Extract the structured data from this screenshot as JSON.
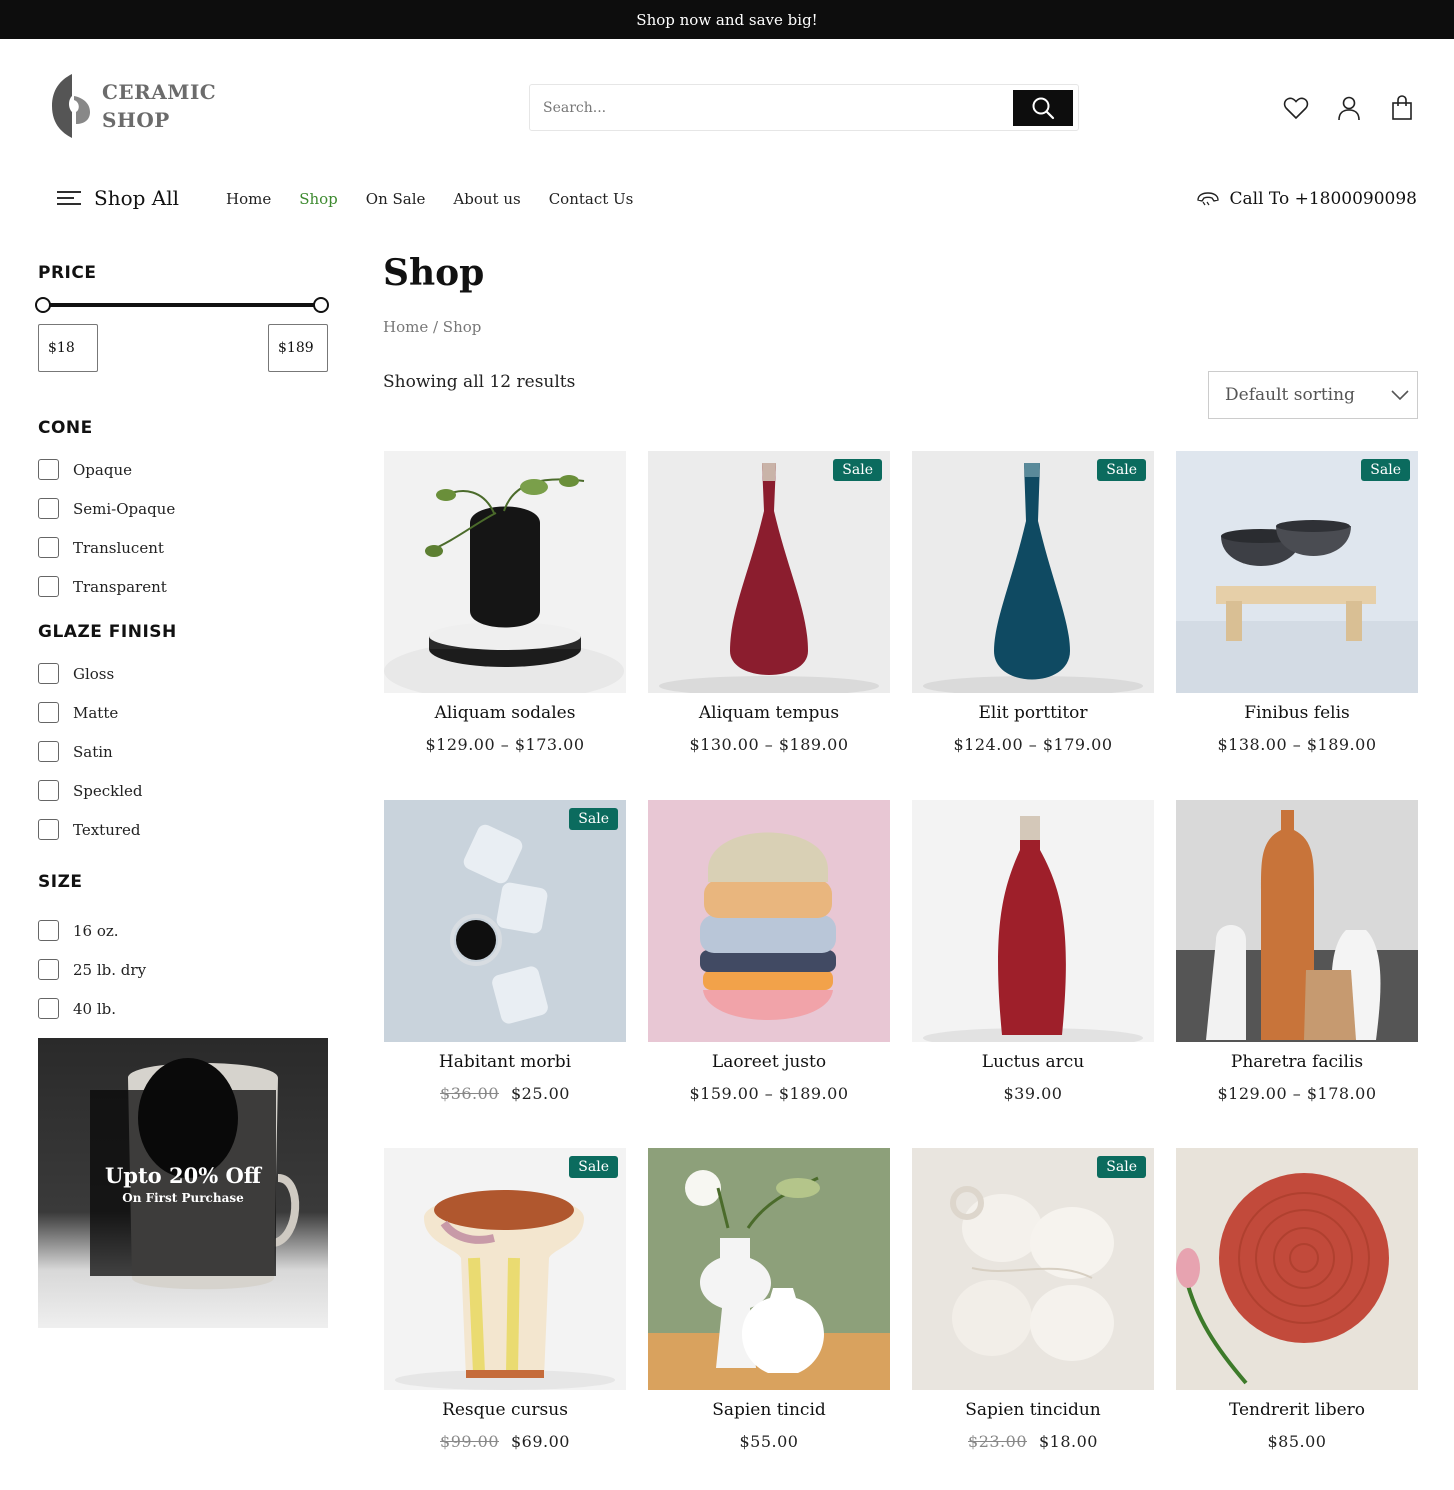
{
  "topbar": {
    "message": "Shop now and save big!"
  },
  "brand": {
    "line1": "CERAMIC",
    "line2": "SHOP"
  },
  "search": {
    "placeholder": "Search..."
  },
  "nav": {
    "shop_all": "Shop All",
    "items": [
      "Home",
      "Shop",
      "On Sale",
      "About us",
      "Contact Us"
    ],
    "active": "Shop",
    "call": "Call To +1800090098"
  },
  "sidebar": {
    "price": {
      "title": "PRICE",
      "min": "$18",
      "max": "$189"
    },
    "cone": {
      "title": "CONE",
      "options": [
        "Opaque",
        "Semi-Opaque",
        "Translucent",
        "Transparent"
      ]
    },
    "glaze": {
      "title": "GLAZE FINISH",
      "options": [
        "Gloss",
        "Matte",
        "Satin",
        "Speckled",
        "Textured"
      ]
    },
    "size": {
      "title": "SIZE",
      "options": [
        "16 oz.",
        "25 lb. dry",
        "40 lb."
      ]
    },
    "promo": {
      "title": "Upto 20% Off",
      "subtitle": "On First Purchase"
    }
  },
  "main": {
    "title": "Shop",
    "breadcrumb": "Home / Shop",
    "result_count": "Showing all 12 results",
    "sort": "Default sorting",
    "sale_label": "Sale"
  },
  "products": [
    {
      "name": "Aliquam sodales",
      "price": "$129.00 – $173.00",
      "old_price": "",
      "sale": false,
      "image": "black-vase-plant"
    },
    {
      "name": "Aliquam tempus",
      "price": "$130.00 – $189.00",
      "old_price": "",
      "sale": true,
      "image": "red-bud-vase"
    },
    {
      "name": "Elit porttitor",
      "price": "$124.00 – $179.00",
      "old_price": "",
      "sale": true,
      "image": "blue-bud-vase"
    },
    {
      "name": "Finibus felis",
      "price": "$138.00 – $189.00",
      "old_price": "",
      "sale": true,
      "image": "bowls-on-stand"
    },
    {
      "name": "Habitant morbi",
      "price": "$25.00",
      "old_price": "$36.00",
      "sale": true,
      "image": "textured-cups"
    },
    {
      "name": "Laoreet justo",
      "price": "$159.00 – $189.00",
      "old_price": "",
      "sale": false,
      "image": "stacked-bowls"
    },
    {
      "name": "Luctus arcu",
      "price": "$39.00",
      "old_price": "",
      "sale": false,
      "image": "red-tall-vase"
    },
    {
      "name": "Pharetra facilis",
      "price": "$129.00 – $178.00",
      "old_price": "",
      "sale": false,
      "image": "bottle-group"
    },
    {
      "name": "Resque cursus",
      "price": "$69.00",
      "old_price": "$99.00",
      "sale": true,
      "image": "painted-pot"
    },
    {
      "name": "Sapien tincid",
      "price": "$55.00",
      "old_price": "",
      "sale": false,
      "image": "white-vases"
    },
    {
      "name": "Sapien tincidun",
      "price": "$18.00",
      "old_price": "$23.00",
      "sale": true,
      "image": "white-cups-pile"
    },
    {
      "name": "Tendrerit libero",
      "price": "$85.00",
      "old_price": "",
      "sale": false,
      "image": "terracotta-plate"
    }
  ],
  "colors": {
    "accent_green": "#3d8a2f",
    "sale_badge": "#0b6b5e",
    "topbar": "#0d0d0d"
  }
}
